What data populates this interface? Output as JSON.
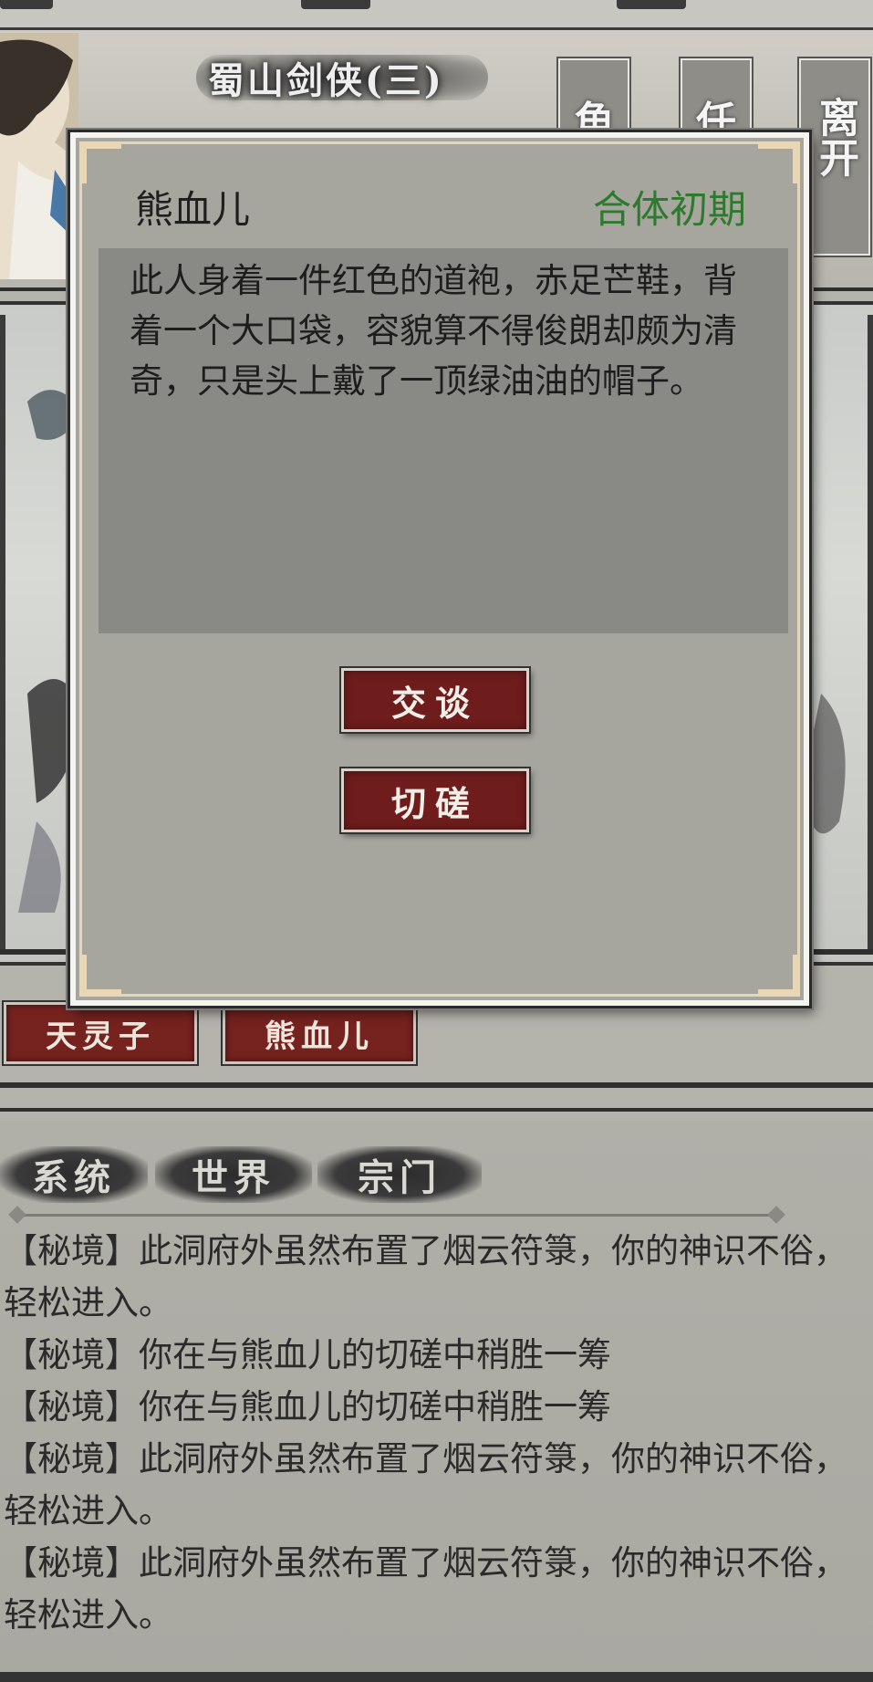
{
  "location": {
    "title": "蜀山剑侠(三)",
    "side_buttons": [
      {
        "label": "角"
      },
      {
        "label": "任"
      },
      {
        "label": "离开"
      }
    ]
  },
  "scene": {
    "npc_buttons": [
      {
        "label": "天灵子"
      },
      {
        "label": "熊血儿"
      }
    ]
  },
  "dialog": {
    "npc_name": "熊血儿",
    "realm": "合体初期",
    "realm_color": "#2d7a2d",
    "description": "此人身着一件红色的道袍，赤足芒鞋，背着一个大口袋，容貌算不得俊朗却颇为清奇，只是头上戴了一顶绿油油的帽子。",
    "buttons": {
      "talk": "交谈",
      "spar": "切磋"
    }
  },
  "log": {
    "tabs": [
      {
        "label": "系统"
      },
      {
        "label": "世界"
      },
      {
        "label": "宗门"
      }
    ],
    "entries": [
      "【秘境】此洞府外虽然布置了烟云符箓，你的神识不俗，轻松进入。",
      "【秘境】你在与熊血儿的切磋中稍胜一筹",
      "【秘境】你在与熊血儿的切磋中稍胜一筹",
      "【秘境】此洞府外虽然布置了烟云符箓，你的神识不俗，轻松进入。",
      "【秘境】此洞府外虽然布置了烟云符箓，你的神识不俗，轻松进入。"
    ]
  },
  "colors": {
    "button_red": "#6f1d1c",
    "panel_gray": "#a6a59e"
  }
}
